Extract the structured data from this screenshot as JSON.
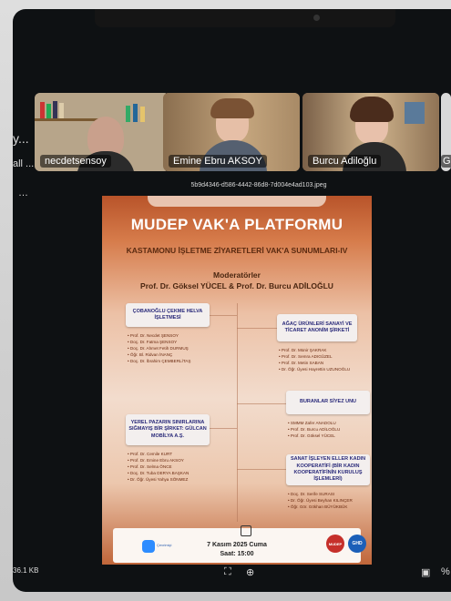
{
  "participants": {
    "left_partial_1": "y...",
    "left_partial_2": "all ...",
    "tile1_name": "necdetsensoy",
    "tile2_name": "Emine Ebru AKSOY",
    "tile3_name": "Burcu Adiloğlu",
    "tile4_partial": "G"
  },
  "file": {
    "name": "5b9d4346-d586-4442-86d8-7d004e4ad103.jpeg",
    "size": "36.1 KB"
  },
  "poster": {
    "title": "MUDEP VAK'A PLATFORMU",
    "subtitle": "KASTAMONU İŞLETME ZİYARETLERİ VAK'A SUNUMLARI-IV",
    "moderator_label": "Moderatörler",
    "moderators": "Prof. Dr. Göksel YÜCEL  &  Prof. Dr. Burcu ADİLOĞLU",
    "box1": "ÇOBANOĞLU ÇEKME HELVA İŞLETMESİ",
    "list1": [
      "Prof. Dr. Necdet ŞENSOY",
      "Doç. Dr. Fatma ŞENSOY",
      "Doç. Dr. Ahmet Fetih DURMUŞ",
      "Öğr. Bl. Ridvan İNANÇ",
      "Doç. Dr. İbrahim ÇEMBERLİTAŞ"
    ],
    "box2": "AĞAÇ ÜRÜNLERİ SANAYİ VE TİCARET ANONİM ŞİRKETİ",
    "list2": [
      "Prof. Dr. Münir ŞAKRAK",
      "Prof. Dr. Semra ADIGÜZEL",
      "Prof. Dr. Metin SABAN",
      "Dr. Öğr. Üyesi Hayrettin UZUNOĞLU"
    ],
    "box3": "BURANLAR SİYEZ UNU",
    "list3": [
      "SMMM Zafer ANADOLU",
      "Prof. Dr. Burcu ADİLOĞLU",
      "Prof. Dr. Göksel YÜCEL"
    ],
    "box4": "YEREL PAZARIN SINIRLARINA SIĞMAYIŞ BİR ŞİRKET: GÜLCAN MOBİLYA A.Ş.",
    "list4": [
      "Prof. Dr. Cemile KURT",
      "Prof. Dr. Emine Ebru AKSOY",
      "Prof. Dr. Selma ÖNCE",
      "Doç. Dr. Tuba DERYA BAŞKAN",
      "Dr. Öğr. Üyesi Yahya SÖNMEZ"
    ],
    "box5": "SANAT İŞLEYEN ELLER KADIN KOOPERATİFİ (BİR KADIN KOOPERATİFİNİN KURULUŞ İŞLEMLERİ)",
    "list5": [
      "Doç. Dr. Serife SURASI",
      "Dr. Öğr. Üyesi Beyhan KILINÇER",
      "Öğr. Gör. Gökhan BÜYÜKBÜK"
    ],
    "zoom_label": "Çevrimiçi",
    "date": "7 Kasım 2025 Cuma",
    "time": "Saat: 15:00",
    "logo1": "MUDEP",
    "logo2": "GHD"
  }
}
